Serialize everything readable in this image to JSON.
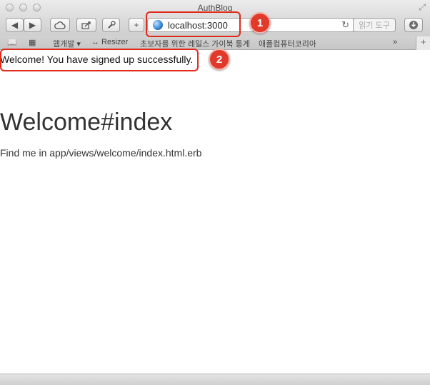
{
  "window": {
    "title": "AuthBlog"
  },
  "toolbar": {
    "url": "localhost:3000",
    "reader_label": "읽기 도구"
  },
  "bookmarks": [
    "웹개발 ▾",
    "↔ Resizer",
    "초보자를 위한 레일스 가이북 통계",
    "애플컴퓨터코리아"
  ],
  "page": {
    "notice": "Welcome! You have signed up successfully.",
    "heading": "Welcome#index",
    "paragraph": "Find me in app/views/welcome/index.html.erb"
  },
  "annotations": {
    "badge1": "1",
    "badge2": "2"
  }
}
